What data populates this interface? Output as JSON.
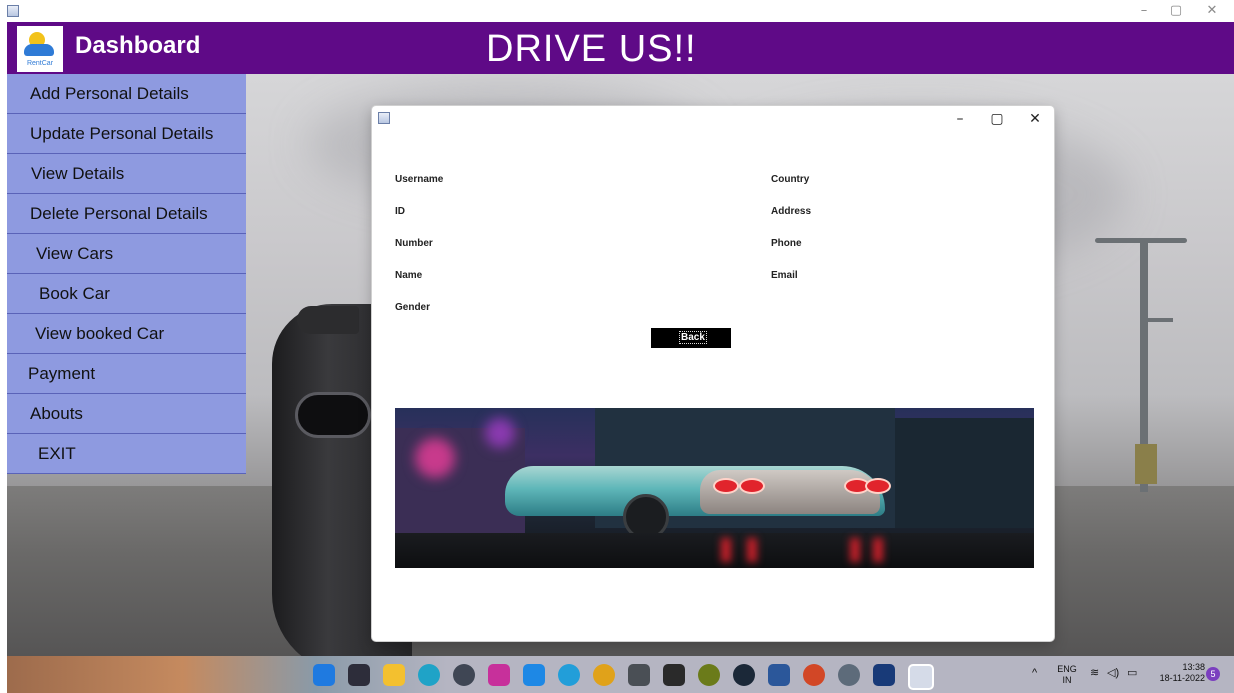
{
  "window": {
    "controls": {
      "minimize": "–",
      "maximize": "▢",
      "close": "✕"
    }
  },
  "header": {
    "logo_text": "RentCar",
    "dashboard_title": "Dashboard",
    "app_title": "DRIVE US!!",
    "color": "#5f0a87"
  },
  "sidebar": {
    "color": "#8e9ae0",
    "items": [
      {
        "label": "Add Personal Details"
      },
      {
        "label": "Update Personal Details"
      },
      {
        "label": "View Details"
      },
      {
        "label": "Delete Personal Details"
      },
      {
        "label": "View Cars"
      },
      {
        "label": "Book Car"
      },
      {
        "label": "View booked Car"
      },
      {
        "label": "Payment"
      },
      {
        "label": "Abouts"
      },
      {
        "label": "EXIT"
      }
    ]
  },
  "dialog": {
    "controls": {
      "minimize": "–",
      "maximize": "▢",
      "close": "✕"
    },
    "left_fields": [
      "Username",
      "ID",
      "Number",
      "Name",
      "Gender"
    ],
    "right_fields": [
      "Country",
      "Address",
      "Phone",
      "Email"
    ],
    "back_label": "Back"
  },
  "taskbar": {
    "language": "ENG",
    "region": "IN",
    "time": "13:38",
    "date": "18-11-2022",
    "badge": "5",
    "tray_caret": "^",
    "icons": [
      "windows-start",
      "task-view",
      "file-explorer",
      "edge",
      "steam-like",
      "instagram",
      "vscode",
      "telegram",
      "chrome",
      "gta",
      "epic-games",
      "xbox",
      "steam",
      "word",
      "powerpoint",
      "settings",
      "virtualbox",
      "java-app"
    ]
  }
}
